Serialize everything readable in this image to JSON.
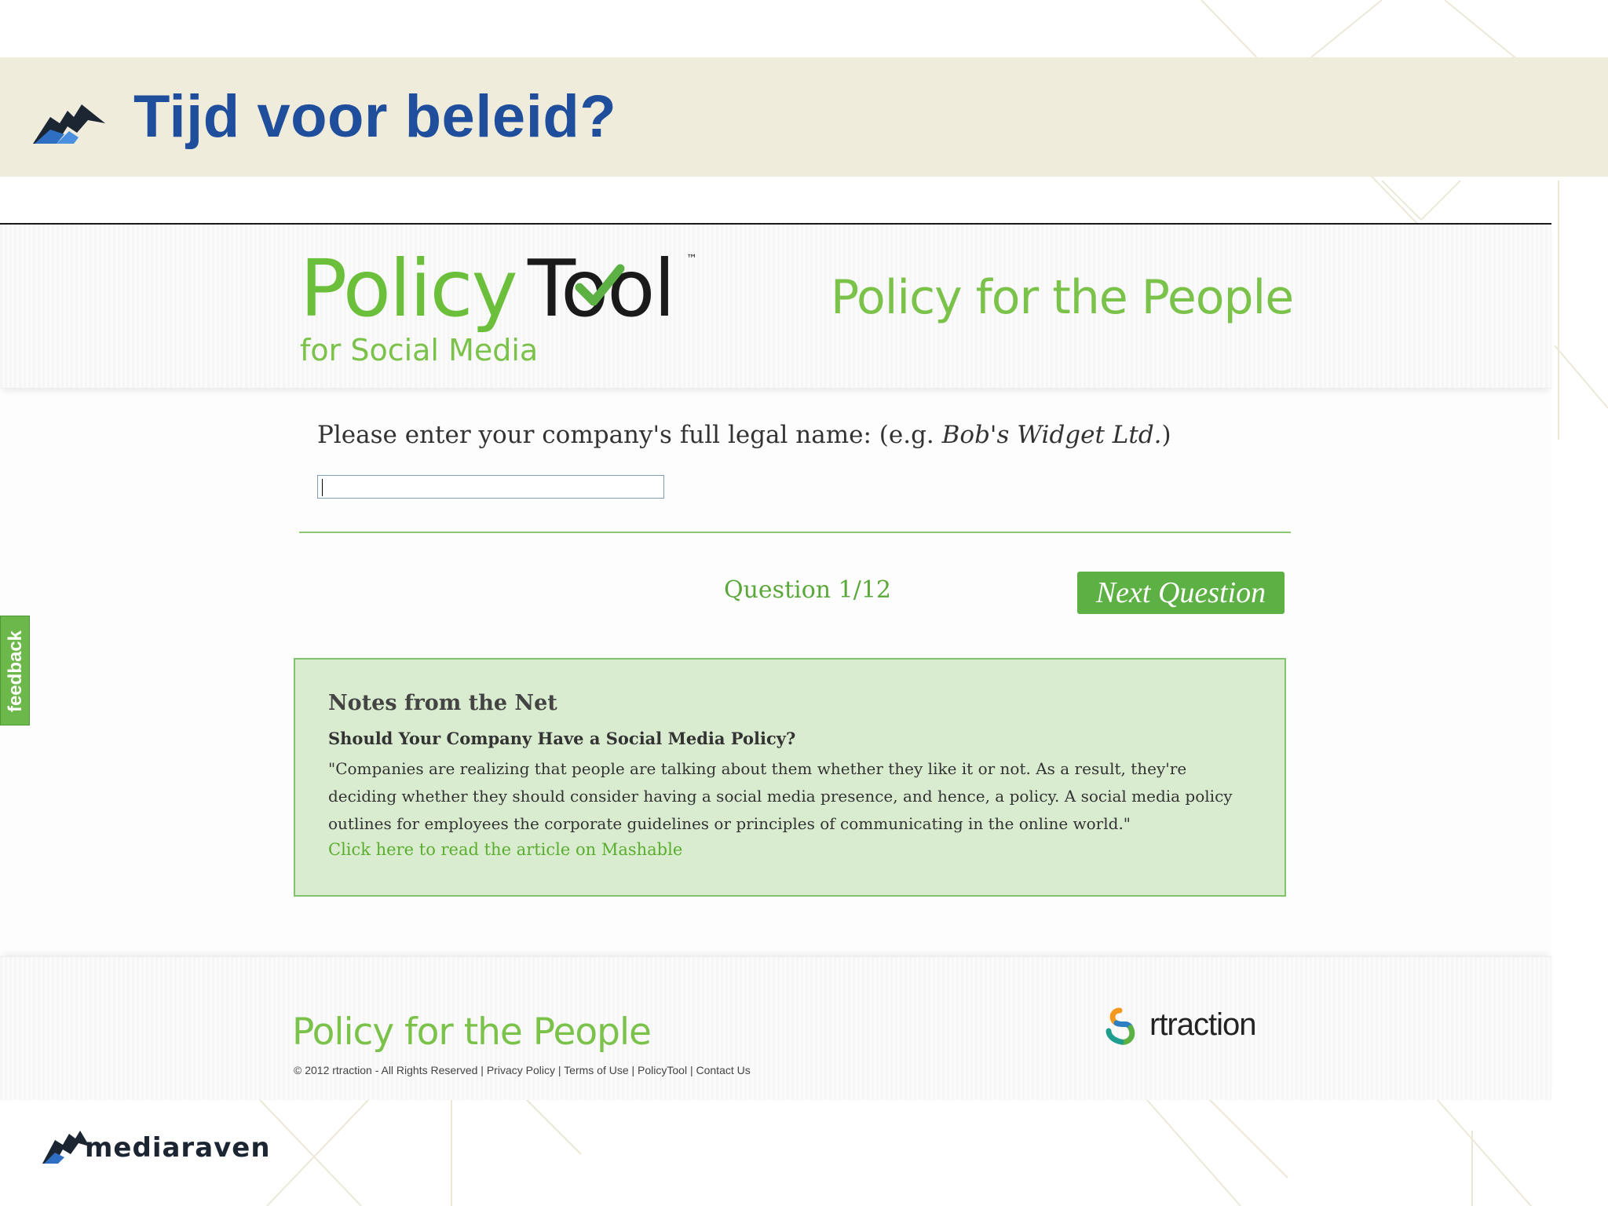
{
  "slide": {
    "title": "Tijd voor beleid?",
    "title_color": "#1f4e9c",
    "band_color": "#f0ecdc",
    "bottom_logo_text": "mediaraven"
  },
  "policytool": {
    "logo_word1": "Policy",
    "logo_word2": "Tool",
    "logo_tm": "™",
    "logo_subtitle": "for Social Media",
    "header_tagline": "Policy for the People",
    "brand_green": "#6cbf3a"
  },
  "question": {
    "label_prefix": "Please enter your company's full legal name: (e.g. ",
    "label_example": "Bob's Widget Ltd.",
    "label_suffix": ")",
    "input_value": "",
    "counter": "Question 1/12",
    "next_button": "Next Question"
  },
  "notes": {
    "title": "Notes from the Net",
    "subtitle": "Should Your Company Have a Social Media Policy?",
    "body": "\"Companies are realizing that people are talking about them whether they like it or not. As a result, they're deciding whether they should consider having a social media presence, and hence, a policy. A social media policy outlines for employees the corporate guidelines or principles of communicating in the online world.\"",
    "link": "Click here to read the article on Mashable"
  },
  "footer": {
    "tagline": "Policy for the People",
    "copyright": "© 2012 rtraction - All Rights Reserved",
    "links": [
      "Privacy Policy",
      "Terms of Use",
      "PolicyTool",
      "Contact Us"
    ],
    "separator": " | ",
    "partner_name": "rtraction"
  },
  "feedback_tab": {
    "label": "feedback"
  }
}
